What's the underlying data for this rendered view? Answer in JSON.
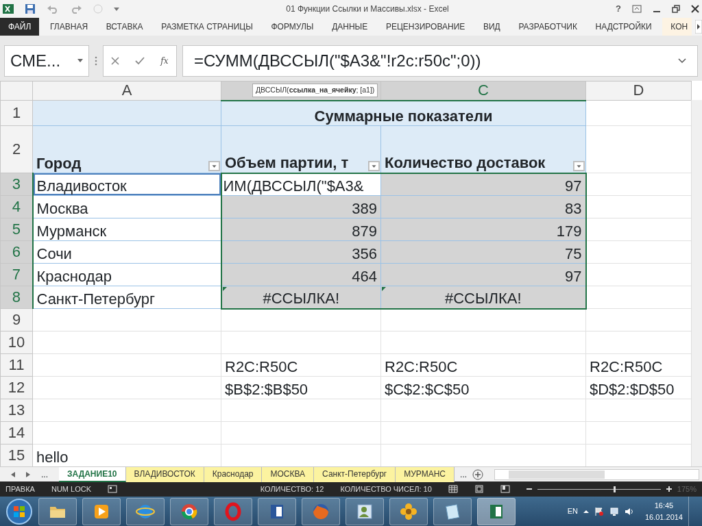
{
  "title_bar": {
    "title": "01 Функции Ссылки и Массивы.xlsx - Excel",
    "help": "?"
  },
  "ribbon_tabs": [
    {
      "label": "ФАЙЛ",
      "kind": "file"
    },
    {
      "label": "ГЛАВНАЯ",
      "kind": "tab"
    },
    {
      "label": "ВСТАВКА",
      "kind": "tab"
    },
    {
      "label": "РАЗМЕТКА СТРАНИЦЫ",
      "kind": "tab"
    },
    {
      "label": "ФОРМУЛЫ",
      "kind": "tab"
    },
    {
      "label": "ДАННЫЕ",
      "kind": "tab"
    },
    {
      "label": "РЕЦЕНЗИРОВАНИЕ",
      "kind": "tab"
    },
    {
      "label": "ВИД",
      "kind": "tab"
    },
    {
      "label": "РАЗРАБОТЧИК",
      "kind": "tab"
    },
    {
      "label": "НАДСТРОЙКИ",
      "kind": "tab"
    },
    {
      "label": "КОН",
      "kind": "addin"
    }
  ],
  "formula_bar": {
    "name_box": "СМЕ...",
    "function_label": "fx",
    "formula": "=СУММ(ДВССЫЛ(\"$A3&\"!r2c:r50c\";0))",
    "tooltip": "ДВССЫЛ(**ссылка_на_ячейку**; [a1])"
  },
  "columns": [
    {
      "label": "A",
      "selected": false
    },
    {
      "selected": true
    },
    {
      "label": "C",
      "selected": true
    },
    {
      "label": "D",
      "selected": false
    }
  ],
  "rows": [
    {
      "number": "1",
      "kind": "title",
      "selected": false,
      "cells": [
        {},
        {
          "kind": "merged",
          "text": "Суммарные показатели"
        },
        {}
      ]
    },
    {
      "number": "2",
      "kind": "header",
      "selected": false,
      "cells": [
        {
          "kind": "text",
          "text": "Город",
          "filter": true
        },
        {
          "kind": "text",
          "text": "Объем партии, т",
          "filter": true
        },
        {
          "kind": "text",
          "text": "Количество доставок",
          "filter": true
        },
        {}
      ]
    },
    {
      "number": "3",
      "kind": "data",
      "selected": true,
      "cells": [
        {
          "kind": "text",
          "text": "Владивосток",
          "referenced": true
        },
        {
          "kind": "text",
          "text": "ИМ(ДВССЫЛ(\"$A3&",
          "selected": true,
          "active": true
        },
        {
          "kind": "number",
          "text": "97",
          "selected": true
        },
        {}
      ]
    },
    {
      "number": "4",
      "kind": "data",
      "selected": true,
      "cells": [
        {
          "kind": "text",
          "text": "Москва"
        },
        {
          "kind": "number",
          "text": "389",
          "selected": true
        },
        {
          "kind": "number",
          "text": "83",
          "selected": true
        },
        {}
      ]
    },
    {
      "number": "5",
      "kind": "data",
      "selected": true,
      "cells": [
        {
          "kind": "text",
          "text": "Мурманск"
        },
        {
          "kind": "number",
          "text": "879",
          "selected": true
        },
        {
          "kind": "number",
          "text": "179",
          "selected": true
        },
        {}
      ]
    },
    {
      "number": "6",
      "kind": "data",
      "selected": true,
      "cells": [
        {
          "kind": "text",
          "text": "Сочи"
        },
        {
          "kind": "number",
          "text": "356",
          "selected": true
        },
        {
          "kind": "number",
          "text": "75",
          "selected": true
        },
        {}
      ]
    },
    {
      "number": "7",
      "kind": "data",
      "selected": true,
      "cells": [
        {
          "kind": "text",
          "text": "Краснодар"
        },
        {
          "kind": "number",
          "text": "464",
          "selected": true
        },
        {
          "kind": "number",
          "text": "97",
          "selected": true
        },
        {}
      ]
    },
    {
      "number": "8",
      "kind": "data",
      "selected": true,
      "cells": [
        {
          "kind": "text",
          "text": "Санкт-Петербург"
        },
        {
          "kind": "error",
          "text": "#ССЫЛКА!",
          "selected": true,
          "error_flag": true
        },
        {
          "kind": "error",
          "text": "#ССЫЛКА!",
          "selected": true,
          "error_flag": true
        },
        {}
      ]
    },
    {
      "number": "9",
      "kind": "plain",
      "selected": false,
      "cells": [
        {},
        {},
        {},
        {}
      ]
    },
    {
      "number": "10",
      "kind": "plain",
      "selected": false,
      "cells": [
        {},
        {},
        {},
        {}
      ]
    },
    {
      "number": "11",
      "kind": "plain",
      "selected": false,
      "cells": [
        {},
        {
          "kind": "text",
          "text": "R2C:R50C"
        },
        {
          "kind": "text",
          "text": "R2C:R50C"
        },
        {
          "kind": "text",
          "text": "R2C:R50C"
        }
      ]
    },
    {
      "number": "12",
      "kind": "plain",
      "selected": false,
      "cells": [
        {},
        {
          "kind": "text",
          "text": "$B$2:$B$50"
        },
        {
          "kind": "text",
          "text": "$C$2:$C$50"
        },
        {
          "kind": "text",
          "text": "$D$2:$D$50"
        }
      ]
    },
    {
      "number": "13",
      "kind": "plain",
      "selected": false,
      "cells": [
        {},
        {},
        {},
        {}
      ]
    },
    {
      "number": "14",
      "kind": "plain",
      "selected": false,
      "cells": [
        {},
        {},
        {},
        {}
      ]
    },
    {
      "number": "15",
      "kind": "plain",
      "selected": false,
      "cells": [
        {
          "kind": "text",
          "text": "hello"
        },
        {},
        {},
        {}
      ]
    }
  ],
  "sheet_tabs": {
    "more_left": "...",
    "more_right": "...",
    "tabs": [
      {
        "label": "ЗАДАНИЕ10",
        "selected": true
      },
      {
        "label": "ВЛАДИВОСТОК",
        "selected": false
      },
      {
        "label": "Краснодар",
        "selected": false
      },
      {
        "label": "МОСКВА",
        "selected": false
      },
      {
        "label": "Санкт-Петербург",
        "selected": false
      },
      {
        "label": "МУРМАНС",
        "selected": false
      }
    ]
  },
  "status_bar": {
    "mode": "ПРАВКА",
    "num_lock": "NUM LOCK",
    "count": "КОЛИЧЕСТВО: 12",
    "numeric_count": "КОЛИЧЕСТВО ЧИСЕЛ: 10",
    "zoom": "175%",
    "zoom_slider": {
      "level": 0.62
    }
  },
  "taskbar": {
    "apps": [
      {
        "kind": "folder",
        "selected": false
      },
      {
        "kind": "player",
        "selected": false
      },
      {
        "kind": "globe",
        "selected": false
      },
      {
        "kind": "chrome",
        "selected": false
      },
      {
        "kind": "ring",
        "selected": false
      },
      {
        "kind": "word",
        "selected": false
      },
      {
        "kind": "fox",
        "selected": false
      },
      {
        "kind": "contact",
        "selected": false
      },
      {
        "kind": "flower",
        "selected": false
      },
      {
        "kind": "notepad",
        "selected": false
      },
      {
        "kind": "excel",
        "selected": true
      }
    ],
    "language": "EN",
    "time": "16:45",
    "date": "16.01.2014"
  }
}
